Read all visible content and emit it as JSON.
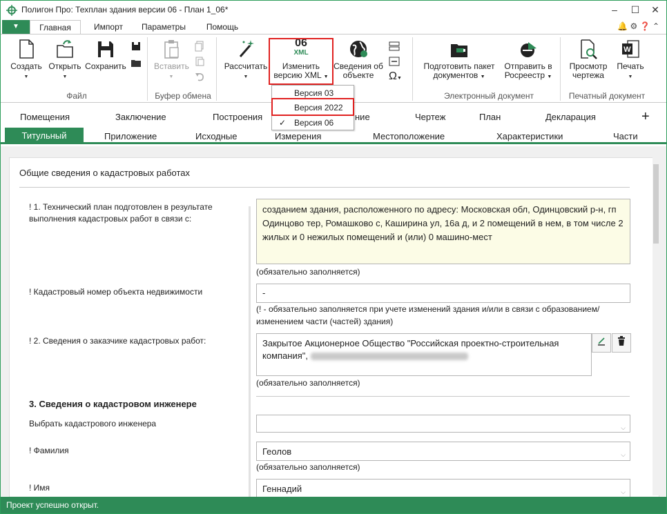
{
  "window": {
    "title": "Полигон Про: Техплан здания версии 06 - План 1_06*"
  },
  "ribbon_tabs": {
    "main": "Главная",
    "import": "Импорт",
    "params": "Параметры",
    "help": "Помощь"
  },
  "ribbon": {
    "file": {
      "create": "Создать",
      "open": "Открыть",
      "save": "Сохранить",
      "group": "Файл"
    },
    "clipboard": {
      "paste": "Вставить",
      "group": "Буфер обмена"
    },
    "calc": "Рассчитать",
    "xml": {
      "version_big": "06",
      "version_xml": "XML",
      "label1": "Изменить",
      "label2": "версию XML"
    },
    "object_info": {
      "line1": "Сведения об",
      "line2": "объекте"
    },
    "edoc": {
      "prepare1": "Подготовить пакет",
      "prepare2": "документов",
      "send1": "Отправить в",
      "send2": "Росреестр",
      "group": "Электронный документ"
    },
    "print": {
      "preview1": "Просмотр",
      "preview2": "чертежа",
      "print": "Печать",
      "group": "Печатный документ"
    }
  },
  "xml_versions": {
    "v1": "Версия 03",
    "v2": "Версия 2022",
    "v3": "Версия 06",
    "checked": "✓"
  },
  "tabs_row1": {
    "rooms": "Помещения",
    "conclusion": "Заключение",
    "buildings": "Построения",
    "situation": "ние",
    "drawing": "Чертеж",
    "plan": "План",
    "declaration": "Декларация",
    "add": "+"
  },
  "tabs_row2": {
    "title": "Титульный",
    "appendix": "Приложение",
    "source": "Исходные",
    "measurements": "Измерения",
    "location": "Местоположение",
    "characteristics": "Характеристики",
    "parts": "Части"
  },
  "form": {
    "section_title": "Общие сведения о кадастровых работах",
    "purpose_label1": "! 1. Технический план подготовлен в результате",
    "purpose_label2": "выполнения кадастровых работ в связи с:",
    "purpose_value": "созданием здания, расположенного по адресу: Московская обл, Одинцовский р-н, гп Одинцово тер, Ромашково с, Каширина ул, 16а д, и 2 помещений в нем, в том числе 2 жилых и 0 нежилых помещений и (или) 0 машино-мест",
    "required": "(обязательно заполняется)",
    "cadastral_label": "! Кадастровый номер объекта недвижимости",
    "cadastral_value": "-",
    "cadastral_note1": "(! - обязательно заполняется при учете изменений здания и/или в связи с образованием/",
    "cadastral_note2": "изменением части (частей) здания)",
    "customer_label": "! 2. Сведения о заказчике кадастровых работ:",
    "customer_value1": "Закрытое Акционерное Общество \"Российская проектно-строительная",
    "customer_value2": "компания\",",
    "engineer_section": "3. Сведения о кадастровом инженере",
    "choose_engineer": "Выбрать кадастрового инженера",
    "surname_label": "! Фамилия",
    "surname_value": "Геолов",
    "name_label": "! Имя",
    "name_value": "Геннадий"
  },
  "status": {
    "text": "Проект успешно открыт."
  }
}
